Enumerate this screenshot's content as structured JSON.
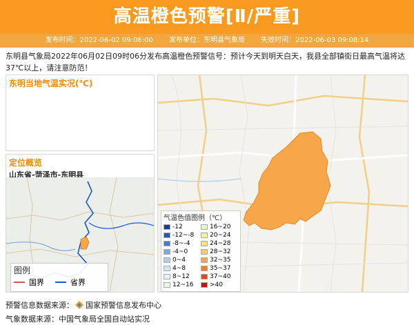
{
  "header": {
    "title": "高温橙色预警[Ⅱ/严重]"
  },
  "meta": {
    "issue_time": "发布时间：2022-06-02 09:06:00",
    "issuer": "发布单位：东明县气象局",
    "expire_time": "失效时间：2022-06-03 09:08:14"
  },
  "description": "东明县气象局2022年06月02日09时06分发布高温橙色预警信号：预计今天到明天白天，我县全部镇街日最高气温将达37℃以上，请注意防范！",
  "panels": {
    "local_temp_title": "东明当地气温实况(℃)",
    "location_title": "定位概览",
    "location_path": "山东省-菏泽市-东明县"
  },
  "locator_legend": {
    "title": "图例",
    "items": [
      {
        "label": "国界",
        "color": "#cc5555"
      },
      {
        "label": "省界",
        "color": "#1a55d6"
      }
    ]
  },
  "temp_legend": {
    "title": "气温色值图例（℃）",
    "items": [
      {
        "label": "-12",
        "color": "#1d3b8f"
      },
      {
        "label": "16~20",
        "color": "#e9f3c9"
      },
      {
        "label": "-12~-8",
        "color": "#2e57a8"
      },
      {
        "label": "20~24",
        "color": "#f3f0a8"
      },
      {
        "label": "-8~-4",
        "color": "#4a7cc6"
      },
      {
        "label": "24~28",
        "color": "#f7e07c"
      },
      {
        "label": "-4~0",
        "color": "#7fa9de"
      },
      {
        "label": "28~32",
        "color": "#f9c96e"
      },
      {
        "label": "0~4",
        "color": "#b5cdea"
      },
      {
        "label": "32~35",
        "color": "#f7a64a"
      },
      {
        "label": "4~8",
        "color": "#d6e5f3"
      },
      {
        "label": "35~37",
        "color": "#f07d2b"
      },
      {
        "label": "8~12",
        "color": "#e8f1f8"
      },
      {
        "label": "37~40",
        "color": "#e2471d"
      },
      {
        "label": "12~16",
        "color": "#eef6e6"
      },
      {
        "label": ">40",
        "color": "#c41414"
      }
    ]
  },
  "footer": {
    "source_warning_prefix": "预警信息数据来源：",
    "source_warning_name": "国家预警信息发布中心",
    "source_weather": "气象数据来源：中国气象局全国自动站实况"
  },
  "colors": {
    "header_bg": "#f79a1f",
    "warning_area": "#f7a64a",
    "accent": "#f08a00"
  }
}
